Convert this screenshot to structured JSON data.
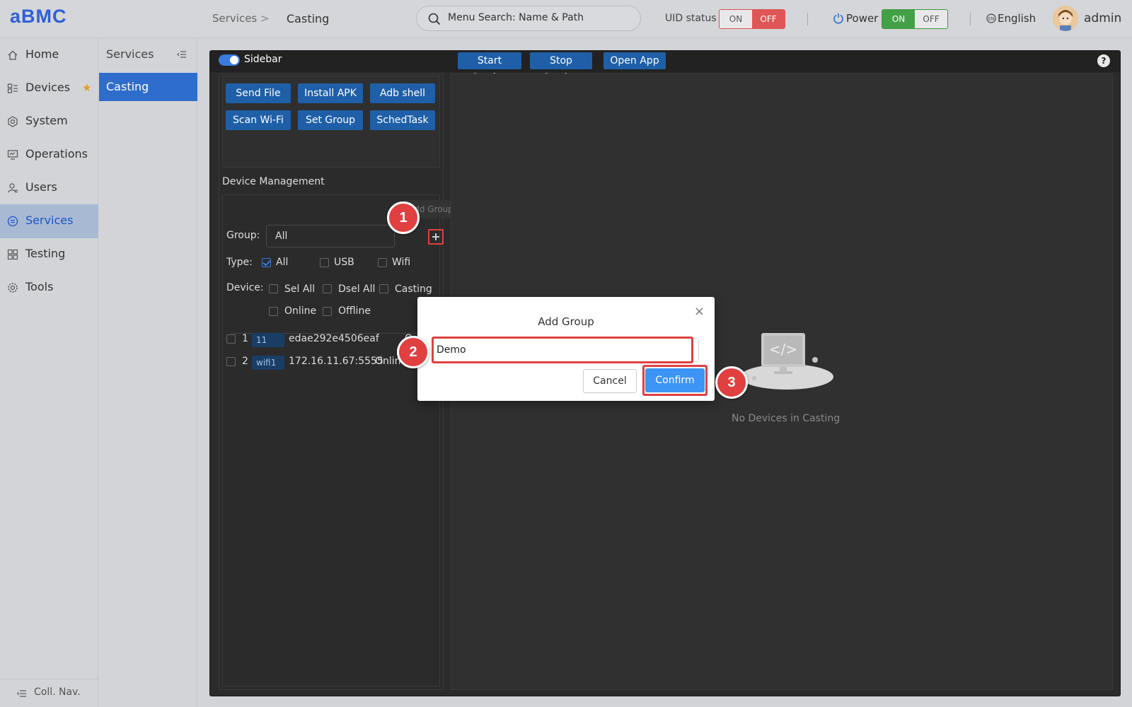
{
  "app": {
    "logo": "aBMC"
  },
  "breadcrumb": {
    "parent": "Services",
    "separator": ">",
    "current": "Casting"
  },
  "search": {
    "placeholder": "Menu Search: Name & Path"
  },
  "uid_status": {
    "label": "UID status",
    "on": "ON",
    "off": "OFF",
    "active": "OFF"
  },
  "power": {
    "label": "Power",
    "on": "ON",
    "off": "OFF",
    "active": "ON"
  },
  "language": {
    "label": "English"
  },
  "user": {
    "name": "admin"
  },
  "nav": {
    "items": [
      {
        "label": "Home",
        "icon": "home-icon"
      },
      {
        "label": "Devices",
        "icon": "devices-icon",
        "starred": true
      },
      {
        "label": "System",
        "icon": "system-icon"
      },
      {
        "label": "Operations",
        "icon": "operations-icon"
      },
      {
        "label": "Users",
        "icon": "users-icon"
      },
      {
        "label": "Services",
        "icon": "services-icon",
        "active": true
      },
      {
        "label": "Testing",
        "icon": "testing-icon"
      },
      {
        "label": "Tools",
        "icon": "tools-icon"
      }
    ],
    "collapse_label": "Coll. Nav."
  },
  "subnav": {
    "title": "Services",
    "items": [
      {
        "label": "Casting",
        "active": true
      }
    ]
  },
  "toolbar": {
    "sidebar_label": "Sidebar",
    "start_casting": "Start Casting",
    "stop_casting": "Stop Casting",
    "open_app": "Open App",
    "help": "?"
  },
  "actions": [
    "Send File",
    "Install APK",
    "Adb shell",
    "Scan Wi-Fi",
    "Set Group",
    "SchedTask"
  ],
  "device_management": {
    "title": "Device Management",
    "tooltip": "Add Group",
    "group_label": "Group:",
    "group_value": "All",
    "type_label": "Type:",
    "types": [
      {
        "label": "All",
        "checked": true
      },
      {
        "label": "USB",
        "checked": false
      },
      {
        "label": "Wifi",
        "checked": false
      }
    ],
    "device_label": "Device:",
    "device_filters": [
      "Sel All",
      "Dsel All",
      "Casting",
      "Online",
      "Offline"
    ],
    "devices": [
      {
        "index": "1",
        "tag": "11",
        "name": "edae292e4506eaf",
        "status": "On"
      },
      {
        "index": "2",
        "tag": "wifi1",
        "name": "172.16.11.67:5555",
        "status": "Onlin"
      }
    ]
  },
  "empty_state": {
    "label": "No Devices in Casting"
  },
  "modal": {
    "title": "Add Group",
    "input_value": "Demo",
    "cancel": "Cancel",
    "confirm": "Confirm",
    "close": "×"
  },
  "steps": [
    "1",
    "2",
    "3"
  ],
  "colors": {
    "accent": "#2e6dcc",
    "highlight": "#e04040",
    "confirm": "#3c94f4",
    "panel_bg": "#2b2b2b"
  }
}
